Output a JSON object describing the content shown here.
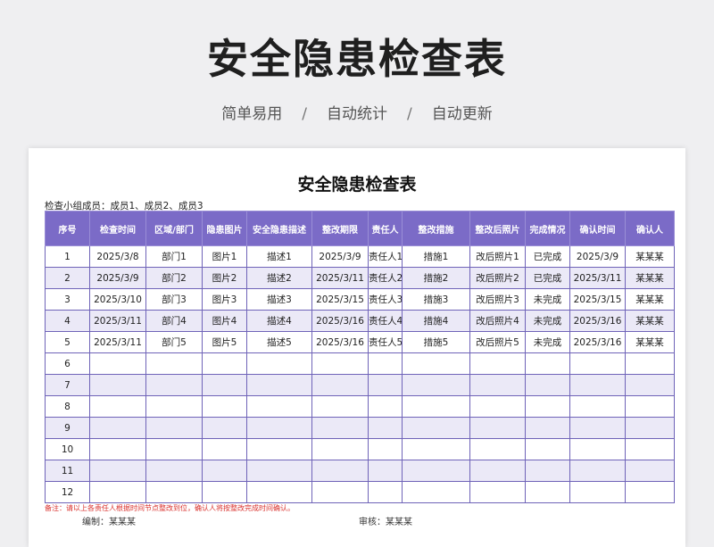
{
  "hero": {
    "title": "安全隐患检查表",
    "tags": [
      "简单易用",
      "自动统计",
      "自动更新"
    ],
    "separator": "/"
  },
  "sheet": {
    "title": "安全隐患检查表",
    "members": "检查小组成员：成员1、成员2、成员3",
    "headers": [
      "序号",
      "检查时间",
      "区域/部门",
      "隐患图片",
      "安全隐患描述",
      "整改期限",
      "责任人",
      "整改措施",
      "整改后照片",
      "完成情况",
      "确认时间",
      "确认人"
    ],
    "rows": [
      [
        "1",
        "2025/3/8",
        "部门1",
        "图片1",
        "描述1",
        "2025/3/9",
        "责任人1",
        "措施1",
        "改后照片1",
        "已完成",
        "2025/3/9",
        "某某某"
      ],
      [
        "2",
        "2025/3/9",
        "部门2",
        "图片2",
        "描述2",
        "2025/3/11",
        "责任人2",
        "措施2",
        "改后照片2",
        "已完成",
        "2025/3/11",
        "某某某"
      ],
      [
        "3",
        "2025/3/10",
        "部门3",
        "图片3",
        "描述3",
        "2025/3/15",
        "责任人3",
        "措施3",
        "改后照片3",
        "未完成",
        "2025/3/15",
        "某某某"
      ],
      [
        "4",
        "2025/3/11",
        "部门4",
        "图片4",
        "描述4",
        "2025/3/16",
        "责任人4",
        "措施4",
        "改后照片4",
        "未完成",
        "2025/3/16",
        "某某某"
      ],
      [
        "5",
        "2025/3/11",
        "部门5",
        "图片5",
        "描述5",
        "2025/3/16",
        "责任人5",
        "措施5",
        "改后照片5",
        "未完成",
        "2025/3/16",
        "某某某"
      ],
      [
        "6",
        "",
        "",
        "",
        "",
        "",
        "",
        "",
        "",
        "",
        "",
        ""
      ],
      [
        "7",
        "",
        "",
        "",
        "",
        "",
        "",
        "",
        "",
        "",
        "",
        ""
      ],
      [
        "8",
        "",
        "",
        "",
        "",
        "",
        "",
        "",
        "",
        "",
        "",
        ""
      ],
      [
        "9",
        "",
        "",
        "",
        "",
        "",
        "",
        "",
        "",
        "",
        "",
        ""
      ],
      [
        "10",
        "",
        "",
        "",
        "",
        "",
        "",
        "",
        "",
        "",
        "",
        ""
      ],
      [
        "11",
        "",
        "",
        "",
        "",
        "",
        "",
        "",
        "",
        "",
        "",
        ""
      ],
      [
        "12",
        "",
        "",
        "",
        "",
        "",
        "",
        "",
        "",
        "",
        "",
        ""
      ]
    ],
    "note": "备注：请以上各责任人根据时间节点整改到位，确认人将按整改完成时间确认。",
    "footer_left": "编制：某某某",
    "footer_right": "审核：某某某"
  },
  "colors": {
    "header_bg": "#7b6bc7",
    "row_alt_bg": "#ebe9f7",
    "border": "#6f63b8",
    "note": "#d9302c"
  }
}
